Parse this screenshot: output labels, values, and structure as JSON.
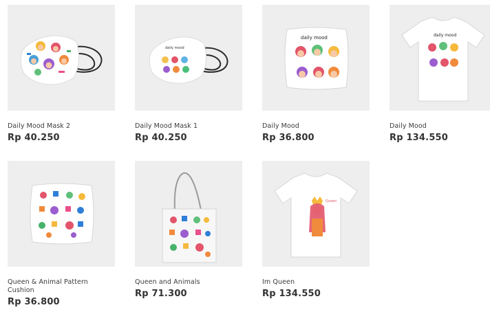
{
  "products": [
    {
      "name": "Daily Mood Mask 2",
      "price": "Rp 40.250",
      "thumbnail": "mask-icon",
      "variant": 2
    },
    {
      "name": "Daily Mood Mask 1",
      "price": "Rp 40.250",
      "thumbnail": "mask-icon",
      "variant": 1
    },
    {
      "name": "Daily Mood",
      "price": "Rp 36.800",
      "thumbnail": "pillow-icon"
    },
    {
      "name": "Daily Mood",
      "price": "Rp 134.550",
      "thumbnail": "tshirt-icon"
    },
    {
      "name": "Queen & Animal Pattern Cushion",
      "price": "Rp 36.800",
      "thumbnail": "pillow-icon"
    },
    {
      "name": "Queen and Animals",
      "price": "Rp 71.300",
      "thumbnail": "tote-bag-icon"
    },
    {
      "name": "Im Queen",
      "price": "Rp 134.550",
      "thumbnail": "tshirt-icon"
    }
  ],
  "colors": {
    "thumb_bg": "#eeeeee",
    "price_text": "#333333",
    "name_text": "#3a3a3a",
    "page_bg": "#ffffff"
  }
}
